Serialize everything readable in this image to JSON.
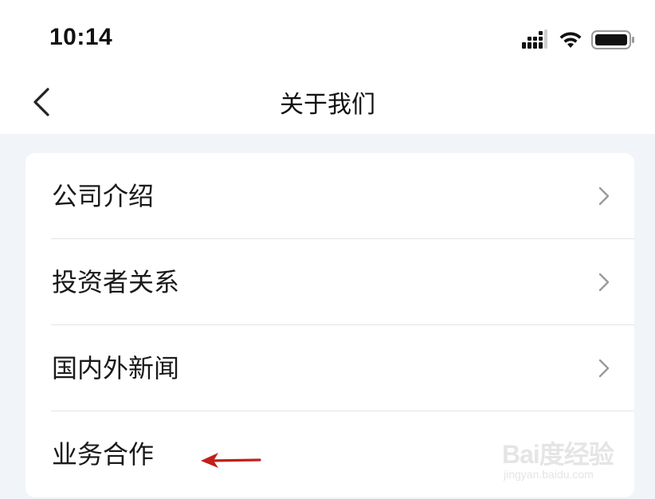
{
  "status_bar": {
    "time": "10:14",
    "icons": [
      "cellular-signal-icon",
      "wifi-icon",
      "battery-icon"
    ]
  },
  "nav": {
    "back_icon": "chevron-left-icon",
    "title": "关于我们"
  },
  "menu": {
    "items": [
      {
        "label": "公司介绍",
        "has_chevron": true
      },
      {
        "label": "投资者关系",
        "has_chevron": true
      },
      {
        "label": "国内外新闻",
        "has_chevron": true
      },
      {
        "label": "业务合作",
        "has_chevron": false
      }
    ]
  },
  "annotation": {
    "arrow_color": "#c0201a",
    "arrow_icon": "red-arrow-pointing-left"
  },
  "watermark": {
    "logo": "Bai度经验",
    "url": "jingyan.baidu.com"
  },
  "colors": {
    "background": "#f1f4f8",
    "card": "#ffffff",
    "text": "#1a1a1a",
    "chevron": "#9a9a9a",
    "divider": "#e4e4e4"
  }
}
